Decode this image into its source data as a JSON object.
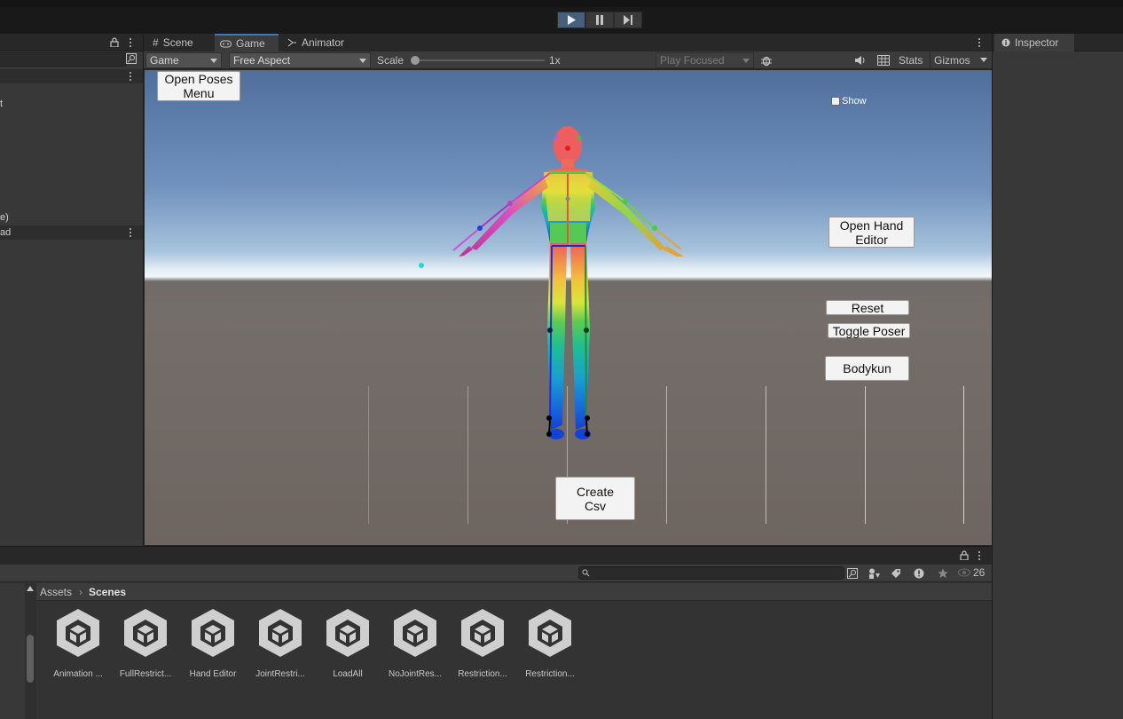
{
  "toolbar": {
    "play_state": "playing"
  },
  "hierarchy": {
    "rows": [
      {
        "text": "t"
      },
      {
        "text": "e)"
      },
      {
        "text": "ad"
      }
    ]
  },
  "game_view": {
    "tabs": [
      {
        "label": "Scene",
        "icon": "hash-icon"
      },
      {
        "label": "Game",
        "icon": "gamepad-icon"
      },
      {
        "label": "Animator",
        "icon": "animator-icon"
      }
    ],
    "display_dropdown": "Game",
    "aspect_dropdown": "Free Aspect",
    "scale_label": "Scale",
    "scale_value": "1x",
    "scale_fraction": 0,
    "play_focused": "Play Focused",
    "stats_label": "Stats",
    "gizmos_label": "Gizmos",
    "overlay": {
      "open_poses_menu": "Open Poses\nMenu",
      "show_label": "Show",
      "open_hand_editor": "Open Hand\nEditor",
      "reset": "Reset",
      "toggle_poser": "Toggle Poser",
      "bodykun": "Bodykun",
      "create_csv": "Create\nCsv"
    }
  },
  "inspector": {
    "tab_label": "Inspector"
  },
  "project": {
    "search_placeholder": "",
    "count": "26",
    "breadcrumb": [
      "Assets",
      "Scenes"
    ],
    "assets": [
      {
        "label": "Animation ..."
      },
      {
        "label": "FullRestrict..."
      },
      {
        "label": "Hand Editor"
      },
      {
        "label": "JointRestri..."
      },
      {
        "label": "LoadAll"
      },
      {
        "label": "NoJointRes..."
      },
      {
        "label": "Restriction..."
      },
      {
        "label": "Restriction..."
      }
    ]
  },
  "colors": {
    "accent": "#3a79bb",
    "play_active": "#46607c"
  }
}
